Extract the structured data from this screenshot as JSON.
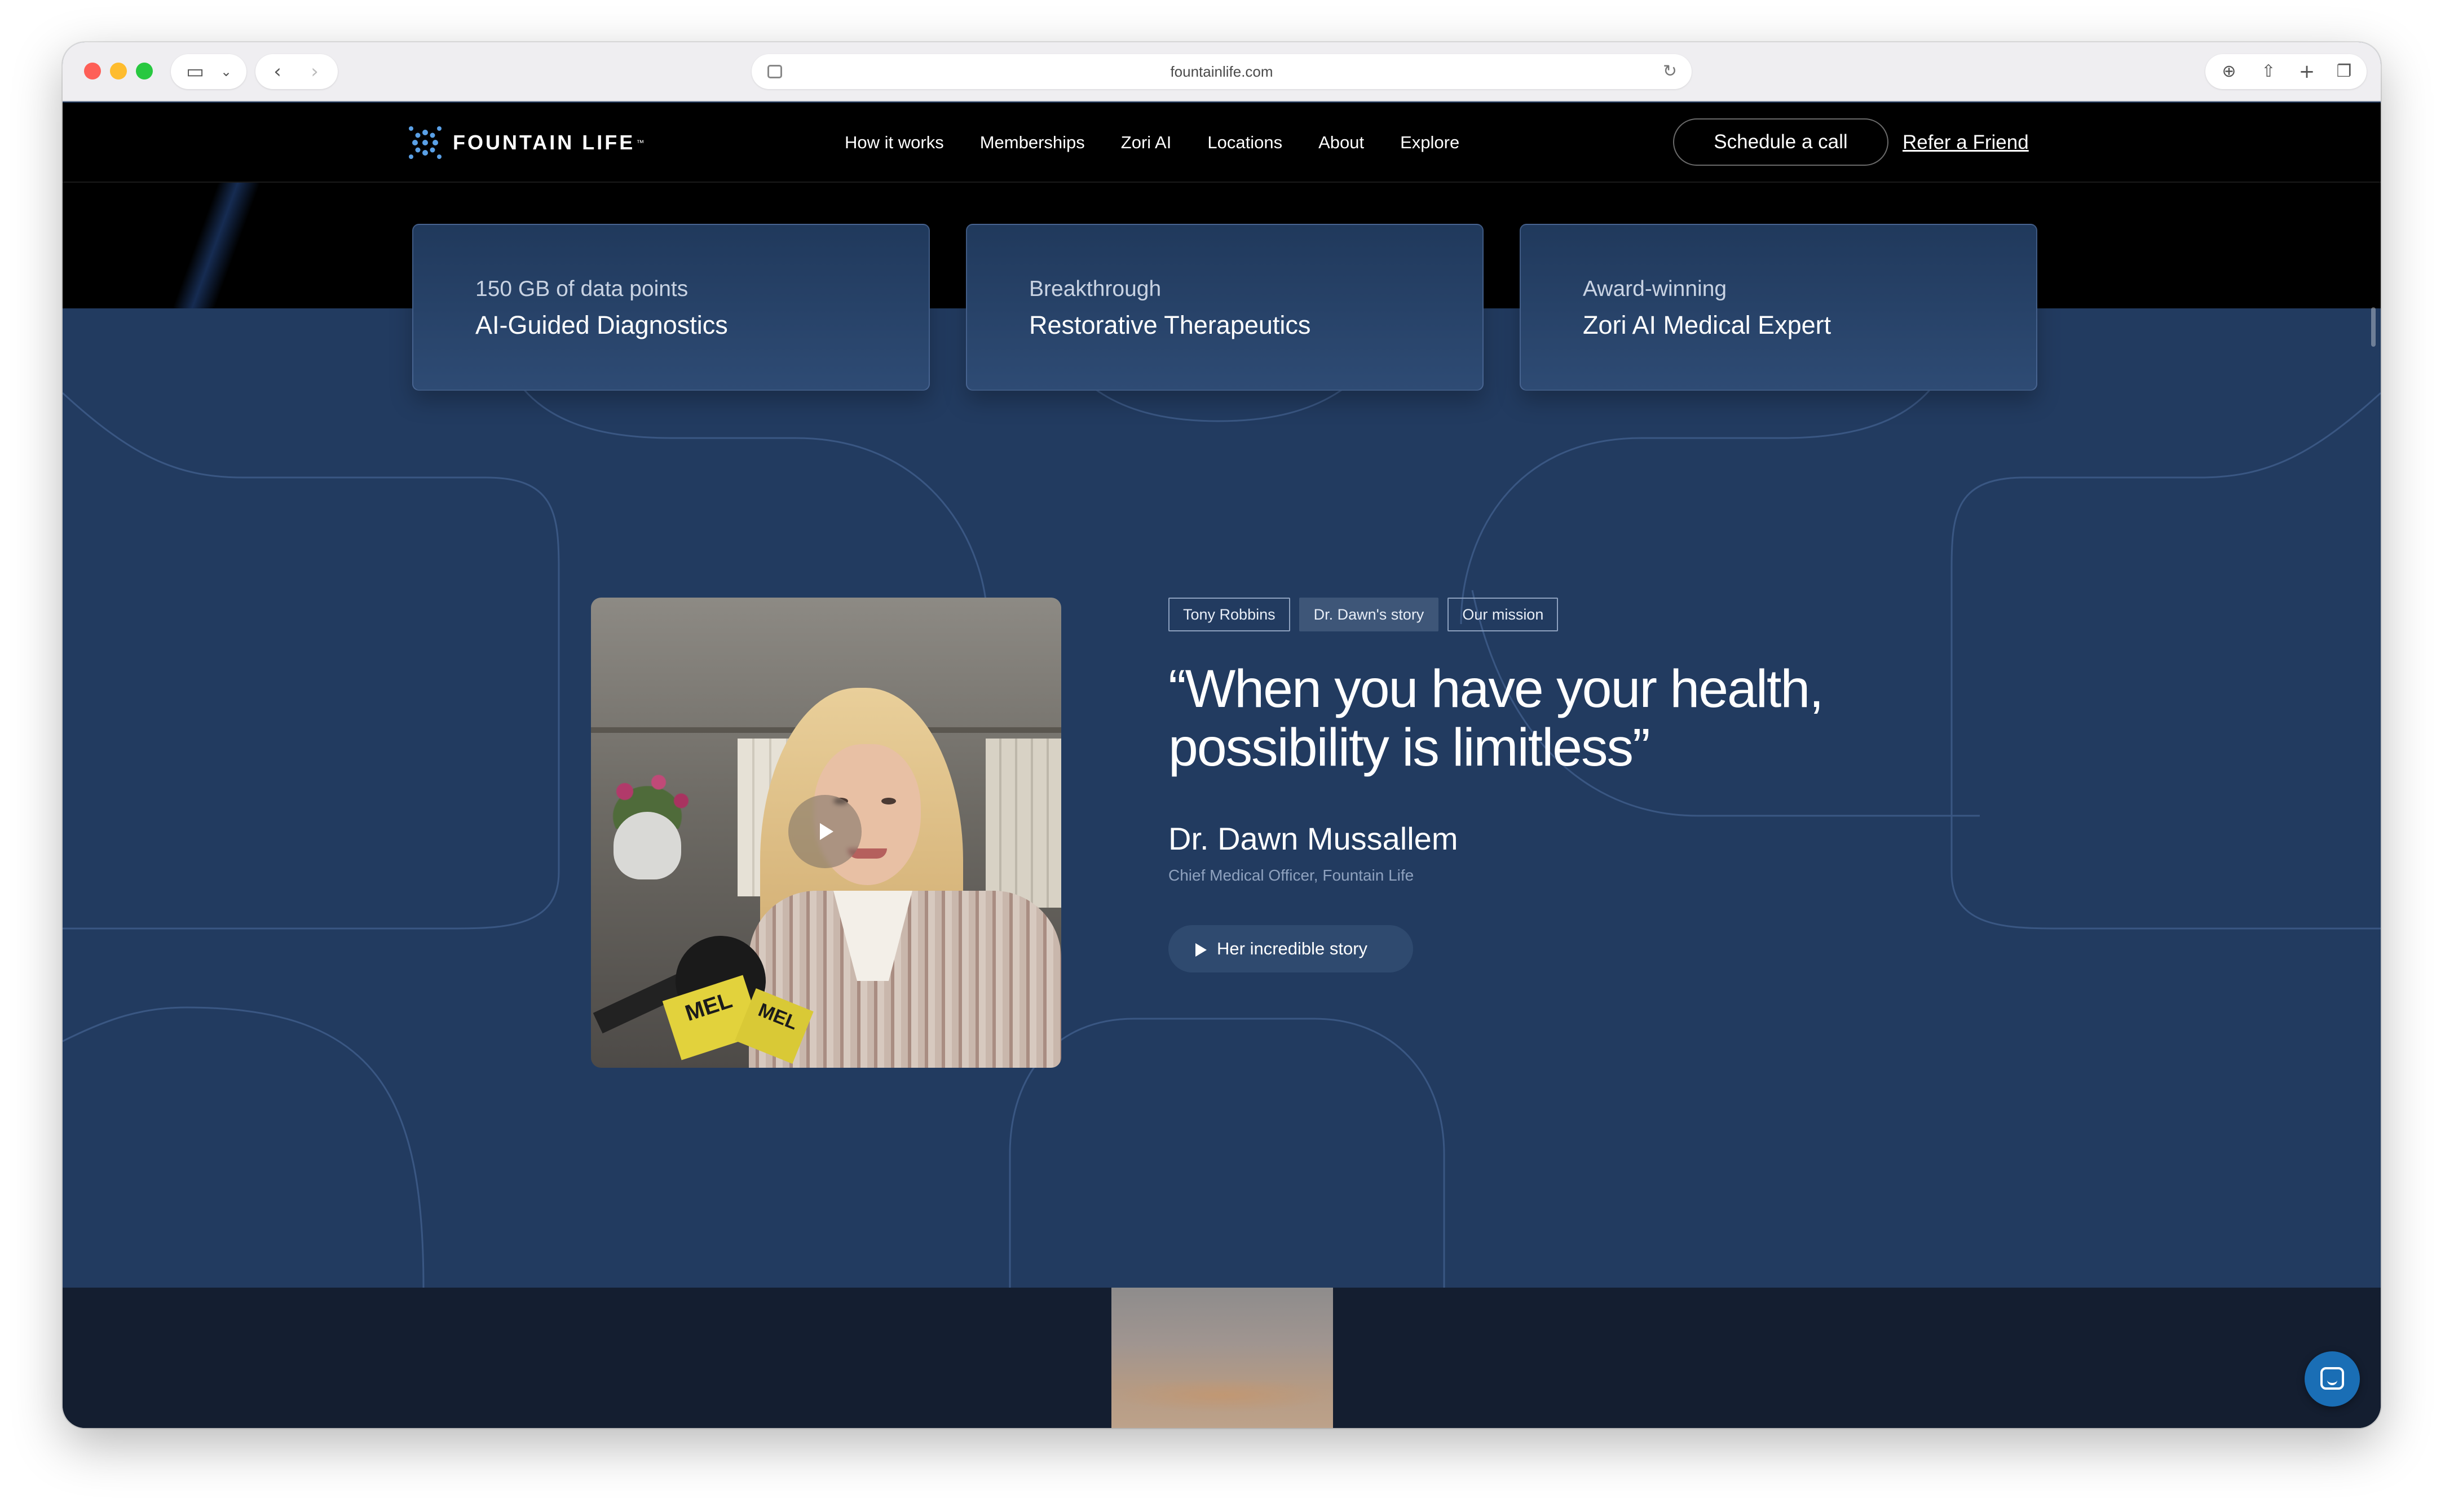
{
  "browser": {
    "url": "fountainlife.com"
  },
  "header": {
    "logo_text": "FOUNTAIN LIFE",
    "logo_tm": "™",
    "nav": [
      "How it works",
      "Memberships",
      "Zori AI",
      "Locations",
      "About",
      "Explore"
    ],
    "schedule_label": "Schedule a call",
    "refer_label": "Refer a Friend"
  },
  "features": [
    {
      "sub": "150 GB of data points",
      "main": "AI-Guided Diagnostics"
    },
    {
      "sub": "Breakthrough",
      "main": "Restorative Therapeutics"
    },
    {
      "sub": "Award-winning",
      "main": "Zori AI Medical Expert"
    }
  ],
  "video": {
    "mic_label": "MEL",
    "mic_label_2": "MEL"
  },
  "testimonial": {
    "tabs": [
      "Tony Robbins",
      "Dr. Dawn's story",
      "Our mission"
    ],
    "active_tab": "Dr. Dawn's story",
    "quote": "“When you have your health, possibility is limitless”",
    "name": "Dr. Dawn Mussallem",
    "title": "Chief Medical Officer, Fountain Life",
    "story_button": "Her incredible story"
  },
  "colors": {
    "header_bg": "#000000",
    "section_bg": "#223b60",
    "lower_bg": "#141e30",
    "chat_button": "#1a6eb5",
    "logo_accent": "#5aa0e6"
  }
}
